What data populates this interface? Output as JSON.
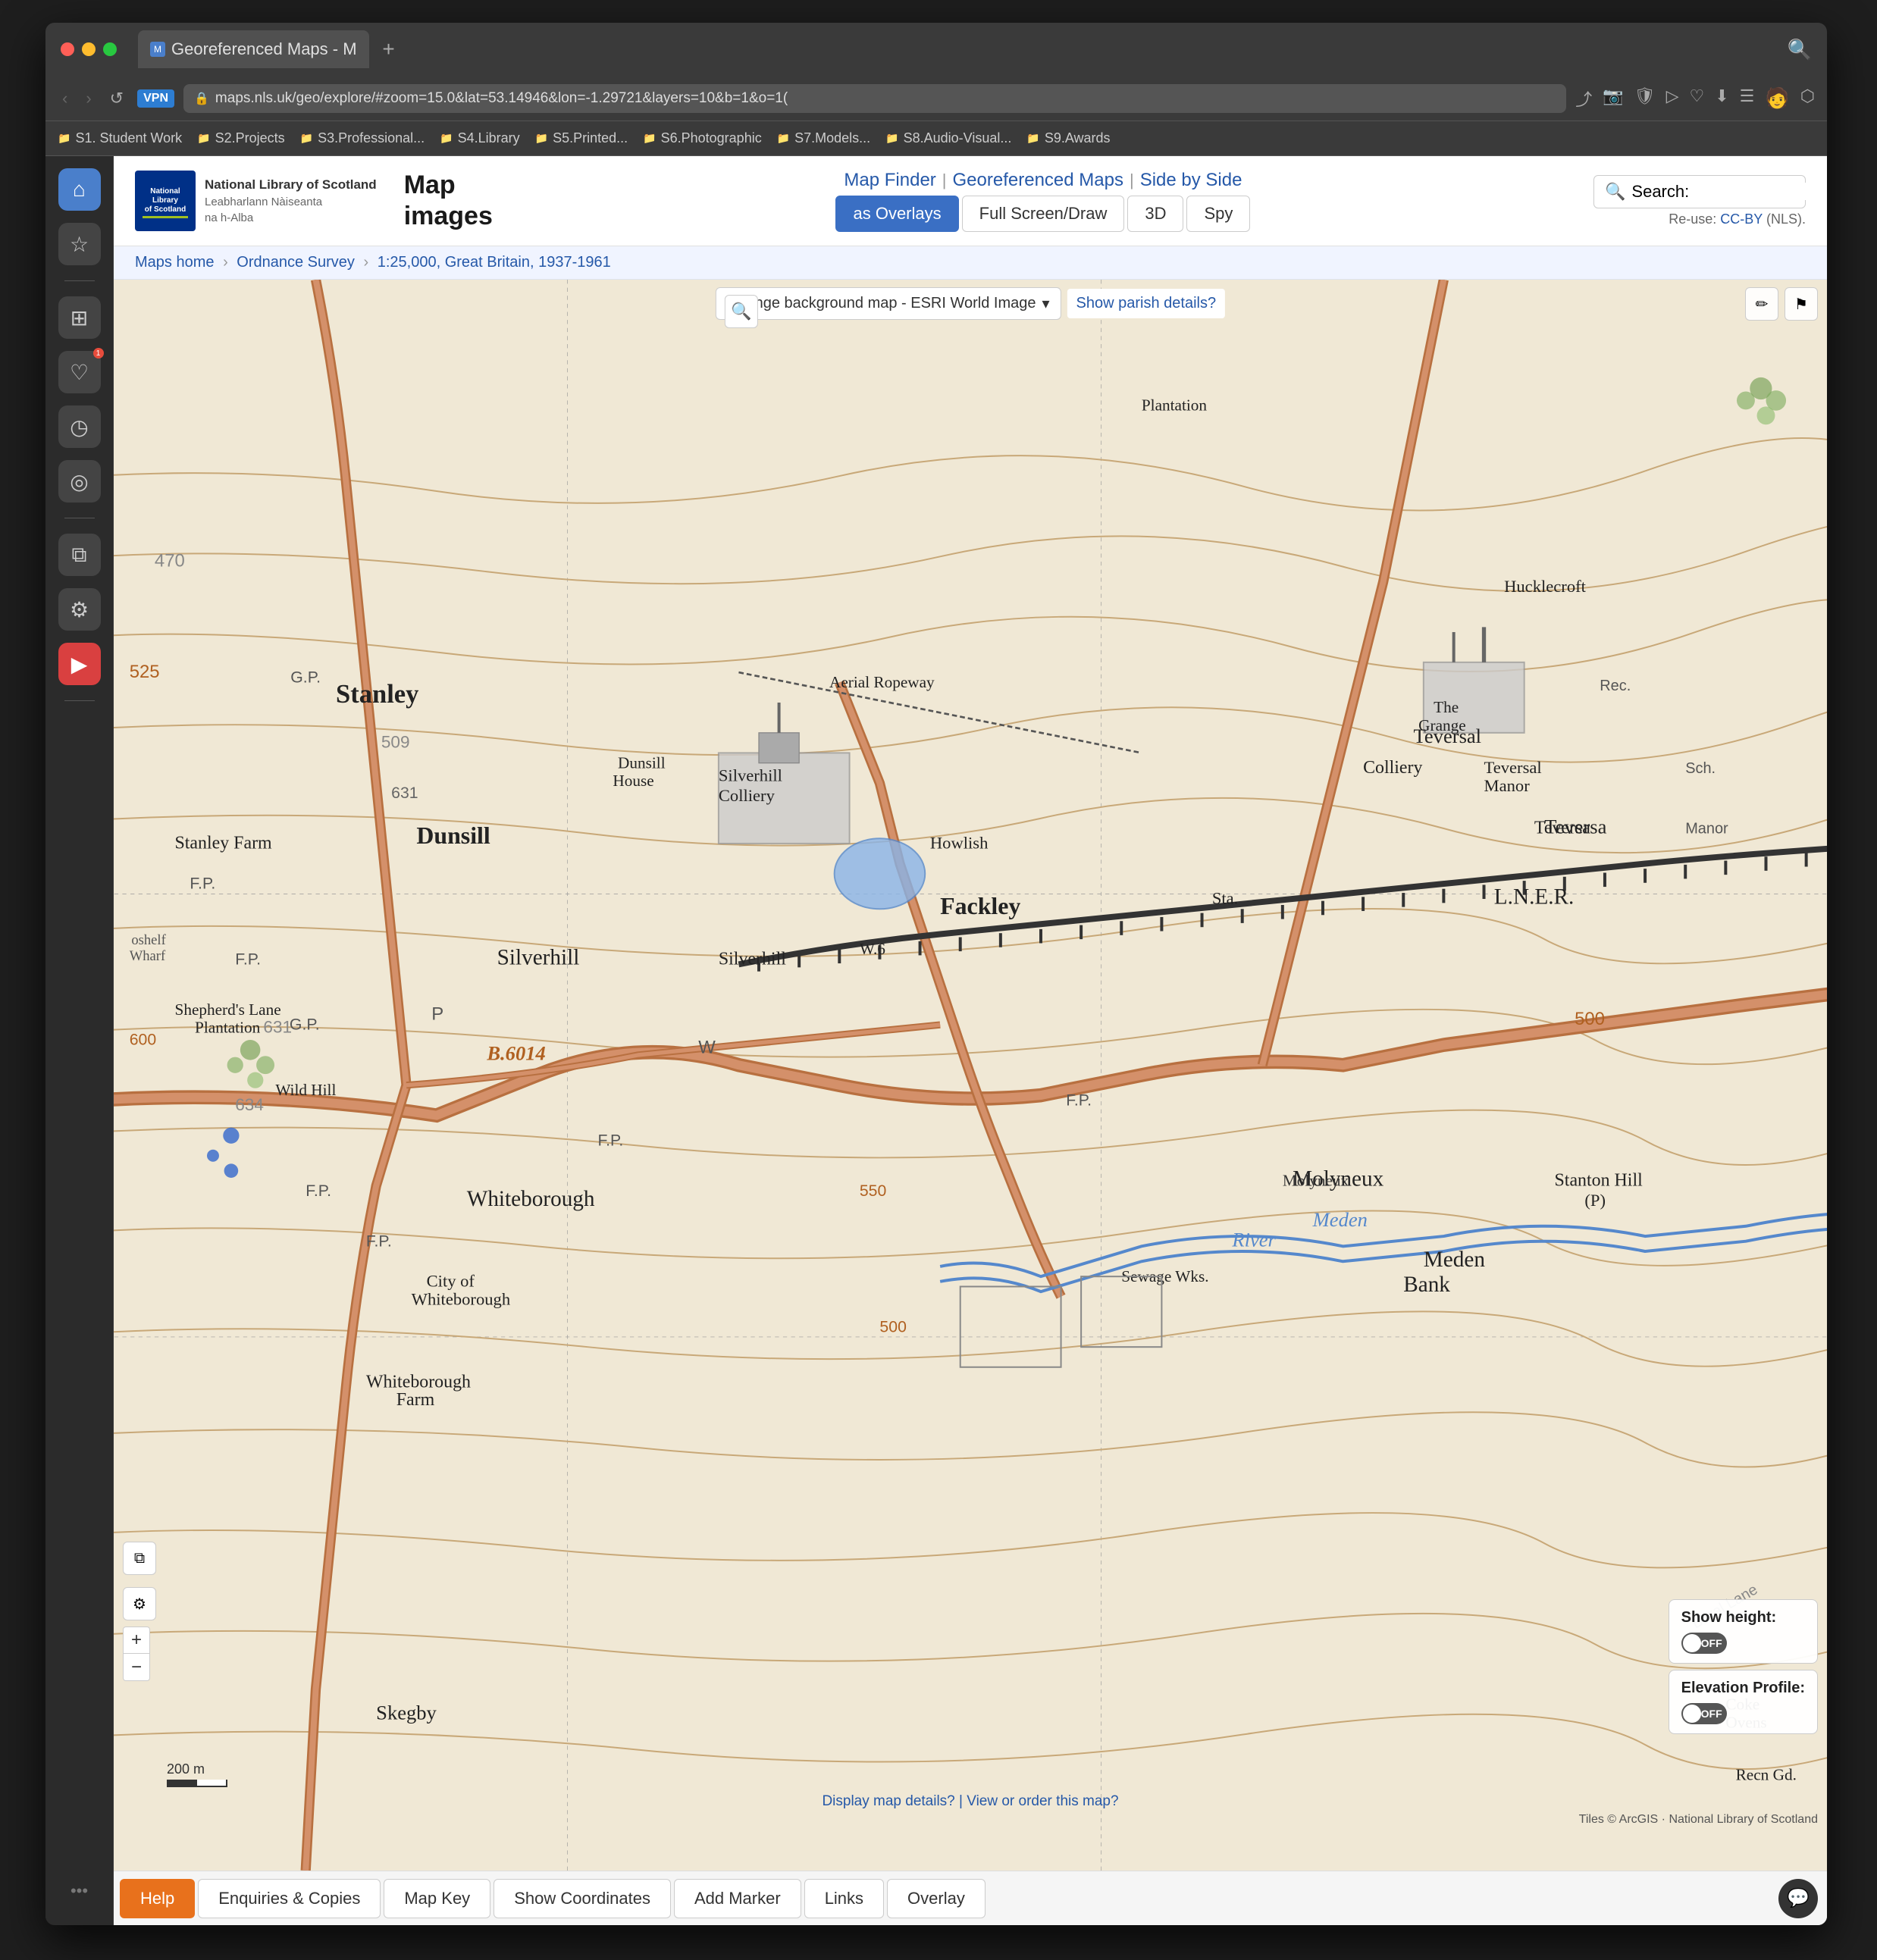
{
  "window": {
    "title": "Georeferenced Maps - M",
    "tab_close": "×",
    "tab_new": "+",
    "search_placeholder": ""
  },
  "browser": {
    "url": "maps.nls.uk/geo/explore/#zoom=15.0&lat=53.14946&lon=-1.29721&layers=10&b=1&o=1(",
    "vpn_label": "VPN",
    "back": "‹",
    "forward": "›",
    "reload": "↺"
  },
  "bookmarks": [
    {
      "label": "S1. Student Work",
      "icon": "📁"
    },
    {
      "label": "S2.Projects",
      "icon": "📁"
    },
    {
      "label": "S3.Professional...",
      "icon": "📁"
    },
    {
      "label": "S4.Library",
      "icon": "📁"
    },
    {
      "label": "S5.Printed...",
      "icon": "📁"
    },
    {
      "label": "S6.Photographic",
      "icon": "📁"
    },
    {
      "label": "S7.Models...",
      "icon": "📁"
    },
    {
      "label": "S8.Audio-Visual...",
      "icon": "📁"
    },
    {
      "label": "S9.Awards",
      "icon": "📁"
    }
  ],
  "sidebar": {
    "icons": [
      {
        "name": "home",
        "symbol": "⌂",
        "style": "blue"
      },
      {
        "name": "star",
        "symbol": "☆",
        "style": "dark"
      },
      {
        "name": "app-grid",
        "symbol": "⊞",
        "style": "dark"
      },
      {
        "name": "heart",
        "symbol": "♡",
        "style": "dark"
      },
      {
        "name": "clock",
        "symbol": "◷",
        "style": "dark"
      },
      {
        "name": "location",
        "symbol": "◎",
        "style": "dark"
      },
      {
        "name": "layers",
        "symbol": "⧉",
        "style": "dark"
      },
      {
        "name": "settings",
        "symbol": "⚙",
        "style": "dark"
      },
      {
        "name": "video",
        "symbol": "▶",
        "style": "red"
      },
      {
        "name": "more",
        "symbol": "•••"
      }
    ]
  },
  "nls": {
    "logo_name": "National Library of Scotland",
    "logo_sub1": "Leabharlann Nàiseanta",
    "logo_sub2": "na h-Alba",
    "header_title": "Map",
    "header_subtitle": "images",
    "nav": {
      "map_finder": "Map Finder",
      "separator1": "|",
      "geo_maps": "Georeferenced Maps",
      "separator2": "|",
      "side_by_side": "Side by Side"
    },
    "buttons": {
      "as_overlays": "as Overlays",
      "full_screen_draw": "Full Screen/Draw",
      "three_d": "3D",
      "spy": "Spy"
    },
    "search_label": "Search:",
    "reuse": "Re-use:",
    "cc_by": "CC-BY",
    "nls": "(NLS)."
  },
  "breadcrumb": {
    "home": "Maps home",
    "sep1": "›",
    "ordnance": "Ordnance Survey",
    "sep2": "›",
    "current": "1:25,000, Great Britain, 1937-1961"
  },
  "map": {
    "background_select": "Change background map - ESRI World Image",
    "parish_link": "Show parish details?",
    "show_height_label": "Show height:",
    "show_height_state": "OFF",
    "elevation_label": "Elevation Profile:",
    "elevation_state": "OFF",
    "scale_text": "200 m",
    "attribution": "Tiles © ArcGIS · National Library of Scotland",
    "detail_link": "Display map details? | View or order this map?",
    "zoom_in": "+",
    "zoom_out": "−"
  },
  "bottom_toolbar": {
    "help": "Help",
    "enquiries": "Enquiries & Copies",
    "map_key": "Map Key",
    "show_coordinates": "Show Coordinates",
    "add_marker": "Add Marker",
    "links": "Links",
    "overlay": "Overlay"
  },
  "map_places": [
    "Stanley",
    "Dunsill",
    "Fackley",
    "Silverhill",
    "Whiteborough",
    "Meden Bank",
    "Stanton Hill",
    "Teversal",
    "Teversall Colliery",
    "Silverhill Colliery",
    "Dunsill House",
    "Stanley Farm",
    "Shepherd's Lane Plantation",
    "Wild Hill",
    "City of Whiteborough",
    "Whiteborough Farm",
    "Skegby",
    "Hucklecroft",
    "Howlish",
    "The Grange",
    "Teversal Manor",
    "LNER",
    "River Meden",
    "Molyneux",
    "Aerial Ropeway",
    "B.6014",
    "Sta.",
    "F.P.",
    "G.P.",
    "Sewage Wks.",
    "Rec.",
    "Sch.",
    "Coke Ovens",
    "Recn Gd."
  ]
}
